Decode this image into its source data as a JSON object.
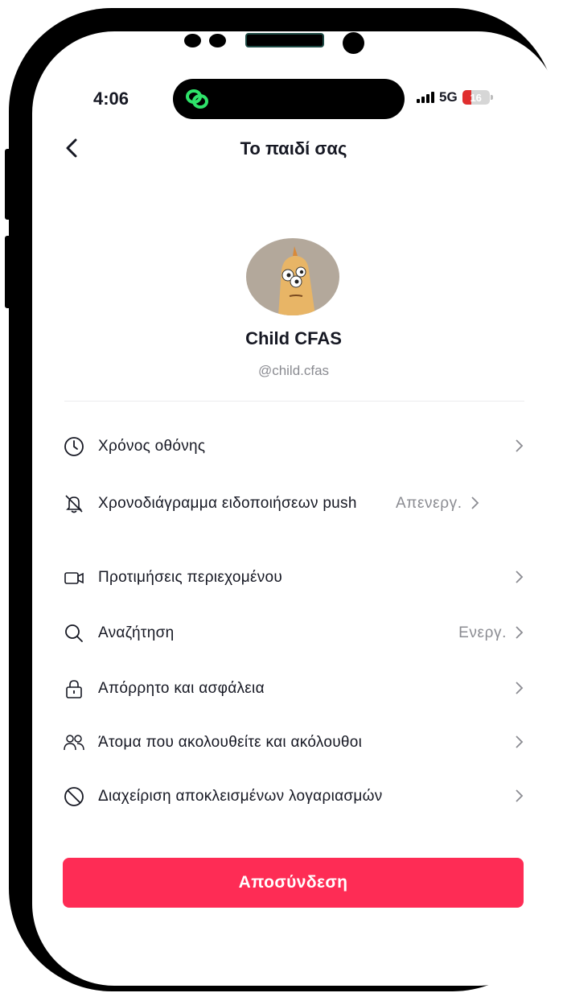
{
  "status_bar": {
    "time": "4:06",
    "network": "5G",
    "battery": "16",
    "battery_level_percent": 16
  },
  "header": {
    "title": "Το παιδί σας",
    "back_icon": "chevron-left-icon"
  },
  "profile": {
    "name": "Child CFAS",
    "handle": "@child.cfas"
  },
  "menu": [
    {
      "label": "Χρόνος οθόνης",
      "value": "",
      "icon": "clock-icon"
    },
    {
      "label": "Χρονοδιάγραμμα ειδοποιήσεων push",
      "value": "Απενεργ.",
      "icon": "bell-off-icon"
    },
    {
      "label": "Προτιμήσεις περιεχομένου",
      "value": "",
      "icon": "video-icon"
    },
    {
      "label": "Αναζήτηση",
      "value": "Ενεργ.",
      "icon": "search-icon"
    },
    {
      "label": "Απόρρητο και ασφάλεια",
      "value": "",
      "icon": "lock-icon"
    },
    {
      "label": "Άτομα που ακολουθείτε και ακόλουθοι",
      "value": "",
      "icon": "users-icon"
    },
    {
      "label": "Διαχείριση αποκλεισμένων λογαριασμών",
      "value": "",
      "icon": "block-icon"
    }
  ],
  "disconnect_button": {
    "label": "Αποσύνδεση"
  },
  "colors": {
    "accent": "#fe2c55",
    "text": "#161823",
    "muted": "#8a8b91"
  }
}
